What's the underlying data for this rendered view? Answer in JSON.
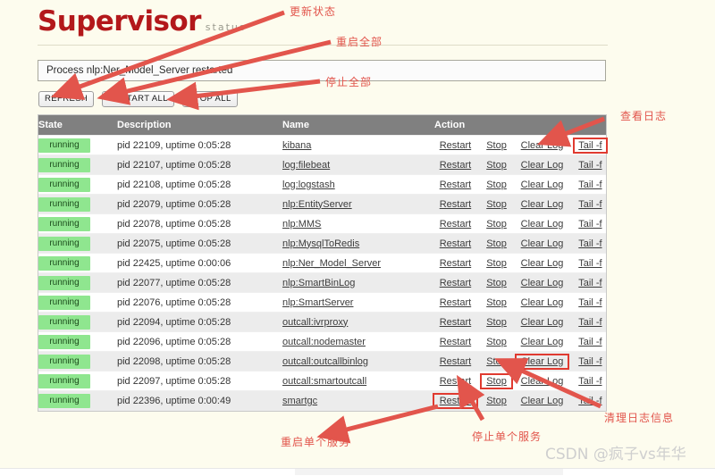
{
  "header": {
    "brand_main": "Supervisor",
    "brand_sub": "status"
  },
  "status": {
    "message": "Process nlp:Ner_Model_Server restarted"
  },
  "toolbar": {
    "refresh_label": "REFRESH",
    "restart_all_label": "RESTART ALL",
    "stop_all_label": "STOP ALL"
  },
  "table": {
    "columns": [
      "State",
      "Description",
      "Name",
      "Action"
    ],
    "action_labels": {
      "restart": "Restart",
      "stop": "Stop",
      "clear_log": "Clear Log",
      "tail": "Tail -f"
    },
    "rows": [
      {
        "state": "running",
        "description": "pid 22109, uptime 0:05:28",
        "name": "kibana"
      },
      {
        "state": "running",
        "description": "pid 22107, uptime 0:05:28",
        "name": "log:filebeat"
      },
      {
        "state": "running",
        "description": "pid 22108, uptime 0:05:28",
        "name": "log:logstash"
      },
      {
        "state": "running",
        "description": "pid 22079, uptime 0:05:28",
        "name": "nlp:EntityServer"
      },
      {
        "state": "running",
        "description": "pid 22078, uptime 0:05:28",
        "name": "nlp:MMS"
      },
      {
        "state": "running",
        "description": "pid 22075, uptime 0:05:28",
        "name": "nlp:MysqlToRedis"
      },
      {
        "state": "running",
        "description": "pid 22425, uptime 0:00:06",
        "name": "nlp:Ner_Model_Server"
      },
      {
        "state": "running",
        "description": "pid 22077, uptime 0:05:28",
        "name": "nlp:SmartBinLog"
      },
      {
        "state": "running",
        "description": "pid 22076, uptime 0:05:28",
        "name": "nlp:SmartServer"
      },
      {
        "state": "running",
        "description": "pid 22094, uptime 0:05:28",
        "name": "outcall:ivrproxy"
      },
      {
        "state": "running",
        "description": "pid 22096, uptime 0:05:28",
        "name": "outcall:nodemaster"
      },
      {
        "state": "running",
        "description": "pid 22098, uptime 0:05:28",
        "name": "outcall:outcallbinlog"
      },
      {
        "state": "running",
        "description": "pid 22097, uptime 0:05:28",
        "name": "outcall:smartoutcall"
      },
      {
        "state": "running",
        "description": "pid 22396, uptime 0:00:49",
        "name": "smartgc"
      }
    ]
  },
  "annotations": {
    "refresh": "更新状态",
    "restart_all": "重启全部",
    "stop_all": "停止全部",
    "view_log": "查看日志",
    "clear_log_info": "清理日志信息",
    "restart_single": "重启单个服务",
    "stop_single": "停止单个服务"
  },
  "watermark": "CSDN @疯子vs年华",
  "colors": {
    "brand": "#b3181b",
    "annotation": "#e2554c",
    "running_badge": "#8fe68f",
    "table_header": "#808080",
    "page_background": "#fdfcee",
    "highlight_box": "#e03a30"
  }
}
